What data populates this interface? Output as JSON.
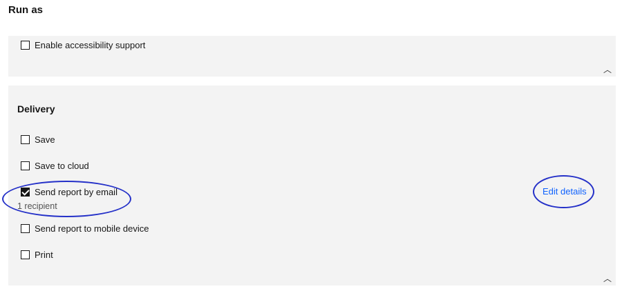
{
  "page": {
    "title": "Run as"
  },
  "run_as": {
    "options": [
      {
        "label": "Enable accessibility support",
        "checked": false
      }
    ],
    "collapse_icon": "chevron-up-icon"
  },
  "delivery": {
    "title": "Delivery",
    "options": [
      {
        "label": "Save",
        "checked": false
      },
      {
        "label": "Save to cloud",
        "checked": false
      },
      {
        "label": "Send report by email",
        "checked": true,
        "sub_label": "1 recipient"
      },
      {
        "label": "Send report to mobile device",
        "checked": false
      },
      {
        "label": "Print",
        "checked": false
      }
    ],
    "edit_details_label": "Edit details",
    "collapse_icon": "chevron-up-icon"
  },
  "colors": {
    "panel_bg": "#f3f3f3",
    "link": "#0f62fe",
    "annotation": "#2430c8"
  }
}
